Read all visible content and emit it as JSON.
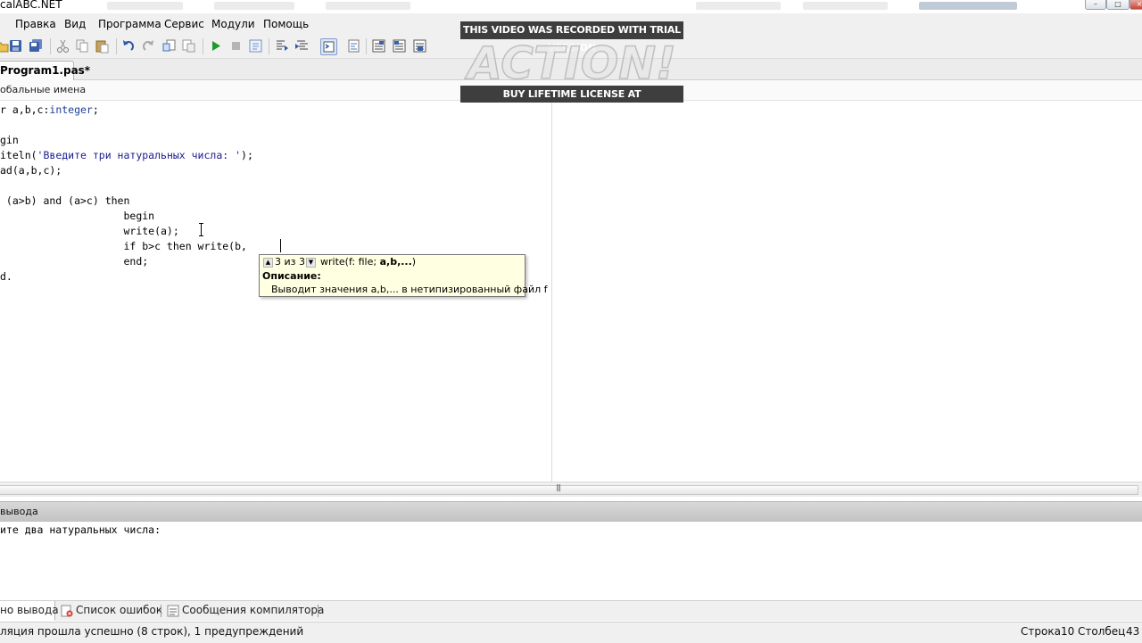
{
  "window": {
    "title": "calABC.NET"
  },
  "menu": {
    "items": [
      "Правка",
      "Вид",
      "Программа",
      "Сервис",
      "Модули",
      "Помощь"
    ]
  },
  "toolbar": {
    "icons": [
      "open-icon",
      "save-icon",
      "save-all-icon",
      "cut-icon",
      "copy-icon",
      "paste-icon",
      "undo-icon",
      "redo-icon",
      "find-icon",
      "replace-icon",
      "run-icon",
      "stop-icon",
      "compile-icon",
      "step-into-icon",
      "step-over-icon",
      "console-icon",
      "format-icon",
      "module-icon",
      "debug-window-icon",
      "watch-icon"
    ]
  },
  "tabs": {
    "active_file": "Program1.pas*"
  },
  "names_combo": {
    "label": "обальные имена"
  },
  "editor": {
    "lines": [
      {
        "pre": "r a,b,c:",
        "type": "integer",
        "post": ";"
      },
      {
        "pre": "",
        "type": "",
        "post": ""
      },
      {
        "pre": "gin",
        "type": "",
        "post": ""
      },
      {
        "pre": "iteln(",
        "str": "'Введите три натуральных числа: '",
        "post": ");"
      },
      {
        "pre": "ad(a,b,c);",
        "type": "",
        "post": ""
      },
      {
        "pre": "",
        "type": "",
        "post": ""
      },
      {
        "pre": " (a>b) and (a>c) then",
        "type": "",
        "post": ""
      },
      {
        "pre": "                    begin",
        "type": "",
        "post": ""
      },
      {
        "pre": "                    write(a);",
        "type": "",
        "post": ""
      },
      {
        "pre": "                    if b>c then write(b,",
        "type": "",
        "post": ""
      },
      {
        "pre": "                    end;",
        "type": "",
        "post": ""
      },
      {
        "pre": "d.",
        "type": "",
        "post": ""
      }
    ],
    "cursor": {
      "row": 10,
      "col": 43
    }
  },
  "tooltip": {
    "counter": "3 из 3",
    "signature_prefix": "write(f: file; ",
    "signature_bold": "a,b,...",
    "signature_suffix": ")",
    "description_title": "Описание:",
    "description_text": "Выводит значения a,b,... в нетипизированный файл f"
  },
  "output": {
    "title": "вывода",
    "text": "ите два натуральных числа:"
  },
  "bottom_tabs": {
    "output": "но вывода",
    "errors": "Список ошибок",
    "compiler": "Сообщения компилятора"
  },
  "status": {
    "message": "ляция прошла успешно (8 строк), 1 предупреждений",
    "row_label": "Строка",
    "row_value": "10",
    "col_label": "Столбец",
    "col_value": "43"
  },
  "watermark": {
    "top": "THIS VIDEO WAS RECORDED WITH TRIAL VERSION",
    "logo": "ACTION!",
    "bottom": "BUY LIFETIME LICENSE AT WWW.MIRILLIS.COM"
  },
  "colors": {
    "menu_bg": "#f0f0f0",
    "keyword_type": "#1d3c97",
    "string": "#1b1b8f",
    "tooltip_bg": "#ffffe1",
    "watermark_bg": "#3e3e3e"
  }
}
